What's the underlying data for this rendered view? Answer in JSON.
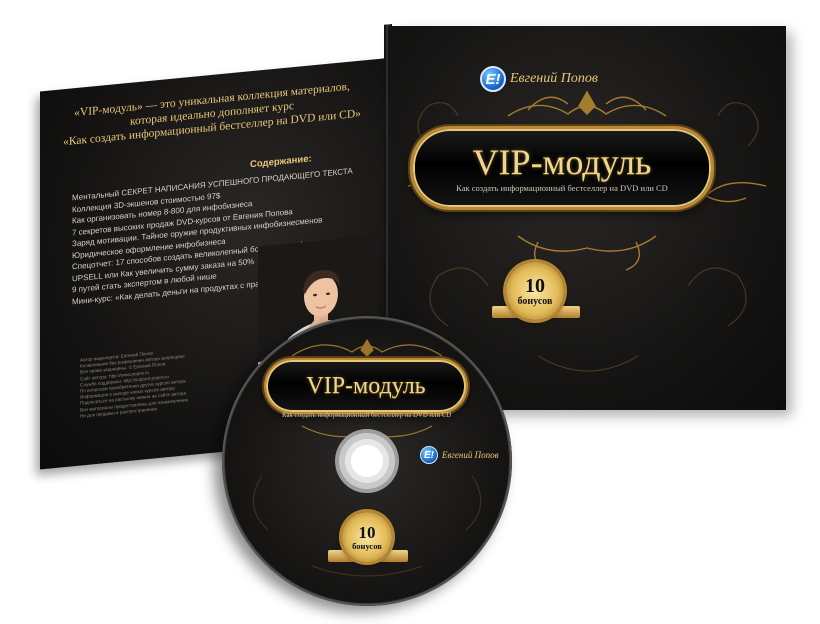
{
  "left_panel": {
    "intro_lines": [
      "«VIP-модуль» — это уникальная коллекция материалов,",
      "которая идеально дополняет курс",
      "«Как создать информационный бестселлер на DVD или CD»"
    ],
    "contents_title": "Содержание:",
    "contents": [
      "Ментальный СЕКРЕТ НАПИСАНИЯ УСПЕШНОГО ПРОДАЮЩЕГО ТЕКСТА",
      "Коллекция 3D-экшенов стоимостью 97$",
      "Как организовать номер 8-800 для инфобизнеса",
      "7 секретов высоких продаж DVD-курсов от Евгения Попова",
      "Заряд мотивации. Тайное оружие продуктивных инфобизнесменов",
      "Юридическое оформление инфобизнеса",
      "Спецотчет: 17 способов создать великолепный бонус для инфопродукта",
      "UPSELL или Как увеличить сумму заказа на 50%",
      "9 путей стать экспертом в любой нише",
      "Мини-курс: «Как делать деньги на продуктах с правами перепродажи»"
    ],
    "credits": [
      "Автор видеокурса: Евгений Попов",
      "Копирование без разрешения автора запрещено",
      "Все права защищены. © Евгений Попов",
      "Сайт автора: http://www.popov.ru",
      "Служба поддержки: http://support.popov.ru",
      "По вопросам приобретения других курсов автора",
      "Информация о выходе новых курсов автора",
      "Подписаться на рассылку можно на сайте автора",
      "Все материалы предоставлены для ознакомления",
      "Не для продажи и распространения"
    ]
  },
  "right_panel": {
    "logo_badge": "Е!",
    "logo_text": "Евгений Попов",
    "title": "VIP-модуль",
    "subtitle": "Как создать информационный бестселлер на DVD или CD",
    "bonus_number": "10",
    "bonus_label": "бонусов"
  },
  "disc": {
    "title": "VIP-модуль",
    "subtitle": "Как создать информационный бестселлер на DVD или CD",
    "logo_badge": "Е!",
    "logo_text": "Евгений Попов",
    "bonus_number": "10",
    "bonus_label": "бонусов"
  },
  "colors": {
    "gold": "#e9c77a",
    "background": "#151413",
    "logo_blue": "#1b6fd1"
  }
}
